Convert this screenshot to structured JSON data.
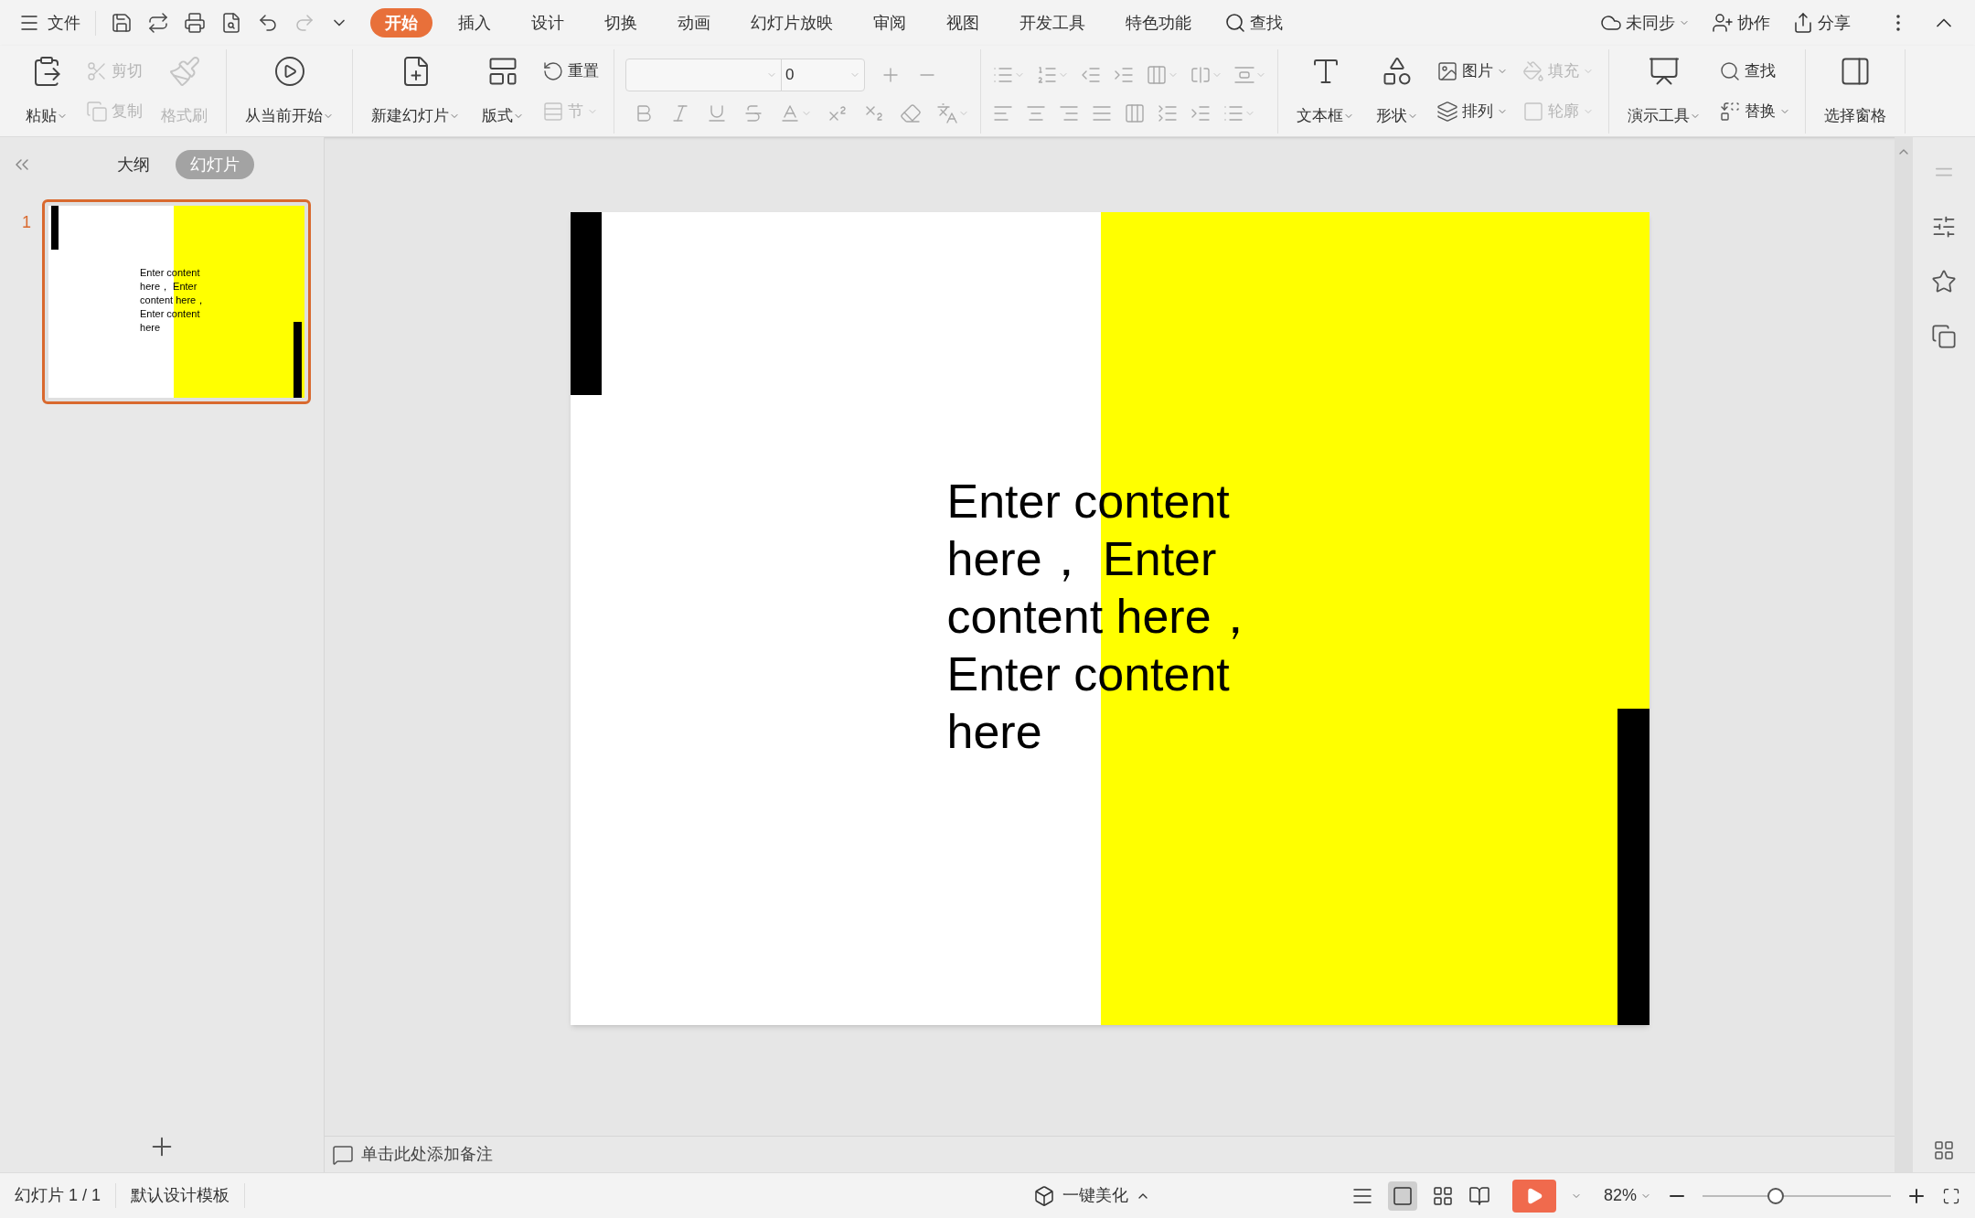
{
  "menu": {
    "file": "文件",
    "tabs": [
      {
        "label": "开始",
        "selected": true
      },
      {
        "label": "插入",
        "selected": false
      },
      {
        "label": "设计",
        "selected": false
      },
      {
        "label": "切换",
        "selected": false
      },
      {
        "label": "动画",
        "selected": false
      },
      {
        "label": "幻灯片放映",
        "selected": false
      },
      {
        "label": "审阅",
        "selected": false
      },
      {
        "label": "视图",
        "selected": false
      },
      {
        "label": "开发工具",
        "selected": false
      },
      {
        "label": "特色功能",
        "selected": false
      }
    ],
    "search": "查找",
    "right": [
      "未同步",
      "协作",
      "分享"
    ]
  },
  "ribbon": [
    {
      "kind": "buttons",
      "items": [
        {
          "kind": "large",
          "label": "粘贴",
          "disabled": false,
          "dropdown": true
        },
        {
          "kind": "stack",
          "items": [
            {
              "label": "剪切",
              "disabled": true,
              "dropdown": false
            },
            {
              "label": "复制",
              "disabled": true,
              "dropdown": false
            }
          ]
        },
        {
          "kind": "large",
          "label": "格式刷",
          "disabled": true,
          "dropdown": false
        }
      ]
    },
    {
      "kind": "buttons",
      "items": [
        {
          "kind": "large",
          "label": "从当前开始",
          "disabled": false,
          "dropdown": true
        }
      ]
    },
    {
      "kind": "buttons",
      "items": [
        {
          "kind": "large",
          "label": "新建幻灯片",
          "disabled": false,
          "dropdown": true
        },
        {
          "kind": "large",
          "label": "版式",
          "disabled": false,
          "dropdown": true
        },
        {
          "kind": "stack",
          "items": [
            {
              "label": "重置",
              "disabled": false,
              "dropdown": false
            },
            {
              "label": "节",
              "disabled": true,
              "dropdown": true
            }
          ]
        }
      ]
    },
    {
      "kind": "font",
      "size": "0"
    },
    {
      "kind": "paragraph"
    },
    {
      "kind": "buttons",
      "items": [
        {
          "kind": "large",
          "label": "文本框",
          "disabled": false,
          "dropdown": true
        },
        {
          "kind": "large",
          "label": "形状",
          "disabled": false,
          "dropdown": true
        },
        {
          "kind": "stack",
          "items": [
            {
              "label": "图片",
              "disabled": false,
              "dropdown": true
            },
            {
              "label": "排列",
              "disabled": false,
              "dropdown": true
            }
          ]
        },
        {
          "kind": "stack",
          "items": [
            {
              "label": "填充",
              "disabled": true,
              "dropdown": true
            },
            {
              "label": "轮廓",
              "disabled": true,
              "dropdown": true
            }
          ]
        }
      ]
    },
    {
      "kind": "buttons",
      "items": [
        {
          "kind": "large",
          "label": "演示工具",
          "disabled": false,
          "dropdown": true
        },
        {
          "kind": "stack",
          "items": [
            {
              "label": "查找",
              "disabled": false,
              "dropdown": false
            },
            {
              "label": "替换",
              "disabled": false,
              "dropdown": true
            }
          ]
        }
      ]
    },
    {
      "kind": "buttons",
      "items": [
        {
          "kind": "large",
          "label": "选择窗格",
          "disabled": false,
          "dropdown": false
        }
      ]
    }
  ],
  "panel": {
    "tabs": [
      {
        "label": "大纲",
        "selected": false
      },
      {
        "label": "幻灯片",
        "selected": true
      }
    ],
    "slides": [
      {
        "number": "1",
        "selected": true,
        "text": "Enter content here， Enter content here，Enter content here"
      }
    ]
  },
  "slide": {
    "text": "Enter content here， Enter content here，Enter content here"
  },
  "notes": {
    "placeholder": "单击此处添加备注"
  },
  "status_bar": {
    "slide": "幻灯片 1 / 1",
    "template": "默认设计模板",
    "beautify": "一键美化",
    "zoom": "82%",
    "zoom_slider": {
      "level": 0.39
    }
  }
}
